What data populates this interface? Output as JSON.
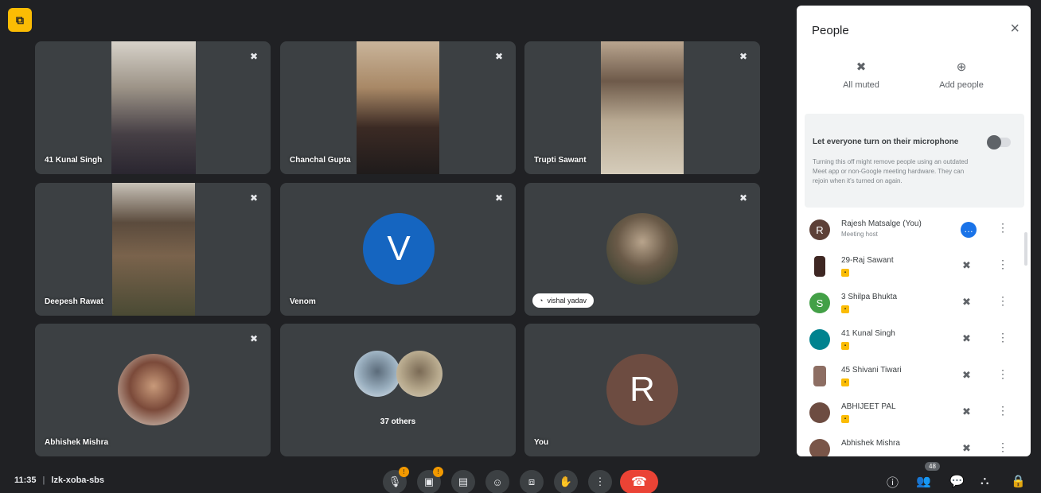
{
  "tiles": [
    {
      "name": "41 Kunal Singh"
    },
    {
      "name": "Chanchal Gupta"
    },
    {
      "name": "Trupti Sawant"
    },
    {
      "name": "Deepesh Rawat"
    },
    {
      "name": "Venom",
      "initial": "V",
      "color": "#1565c0"
    },
    {
      "name": "vishal yadav"
    },
    {
      "name": "Abhishek Mishra"
    },
    {
      "name": "37 others"
    },
    {
      "name": "You",
      "initial": "R",
      "color": "#6d4c41"
    }
  ],
  "panel": {
    "title": "People",
    "close_icon": "×",
    "all_muted_label": "All muted",
    "add_people_label": "Add people",
    "mic_setting": {
      "title": "Let everyone turn on their microphone",
      "description": "Turning this off might remove people using an outdated Meet app or non-Google meeting hardware. They can rejoin when it's turned on again.",
      "enabled": false
    },
    "people": [
      {
        "name": "Rajesh Matsalge (You)",
        "role": "Meeting host",
        "initial": "R",
        "color": "#5d4037",
        "host": true
      },
      {
        "name": "29-Raj Sawant",
        "color": "#3e2723"
      },
      {
        "name": "3 Shilpa Bhukta",
        "initial": "S",
        "color": "#43a047"
      },
      {
        "name": "41 Kunal Singh",
        "color": "#00838f"
      },
      {
        "name": "45 Shivani Tiwari",
        "color": "#8d6e63"
      },
      {
        "name": "ABHIJEET PAL",
        "color": "#6d4c41"
      },
      {
        "name": "Abhishek Mishra",
        "color": "#795548"
      }
    ]
  },
  "bottom": {
    "time": "11:35",
    "separator": "|",
    "meeting_code": "lzk-xoba-sbs",
    "participant_count": "48"
  }
}
